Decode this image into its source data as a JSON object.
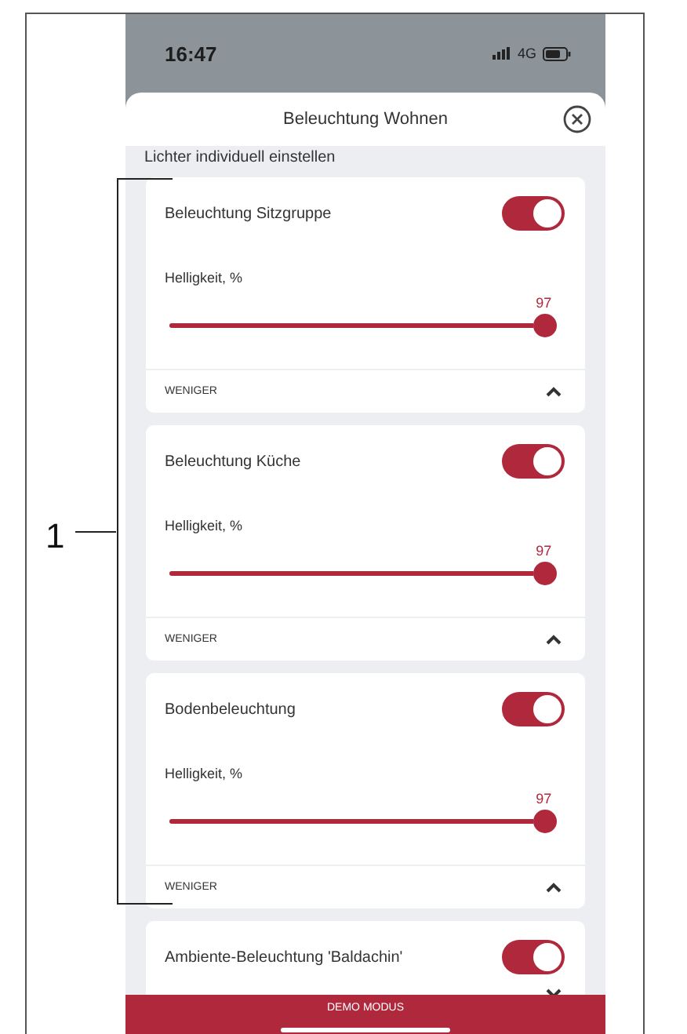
{
  "status_bar": {
    "time": "16:47",
    "network": "4G"
  },
  "sheet": {
    "title": "Beleuchtung Wohnen",
    "section_label": "Lichter individuell einstellen",
    "lights": [
      {
        "name": "Beleuchtung Sitzgruppe",
        "on": true,
        "expanded": true,
        "brightness_label": "Helligkeit, %",
        "value": "97",
        "level": 0.97,
        "collapse_label": "WENIGER"
      },
      {
        "name": "Beleuchtung Küche",
        "on": true,
        "expanded": true,
        "brightness_label": "Helligkeit, %",
        "value": "97",
        "level": 0.97,
        "collapse_label": "WENIGER"
      },
      {
        "name": "Bodenbeleuchtung",
        "on": true,
        "expanded": true,
        "brightness_label": "Helligkeit, %",
        "value": "97",
        "level": 0.97,
        "collapse_label": "WENIGER"
      },
      {
        "name": "Ambiente-Beleuchtung 'Baldachin'",
        "on": true,
        "expanded": false
      }
    ]
  },
  "demo_bar": "DEMO MODUS",
  "callout": "1"
}
